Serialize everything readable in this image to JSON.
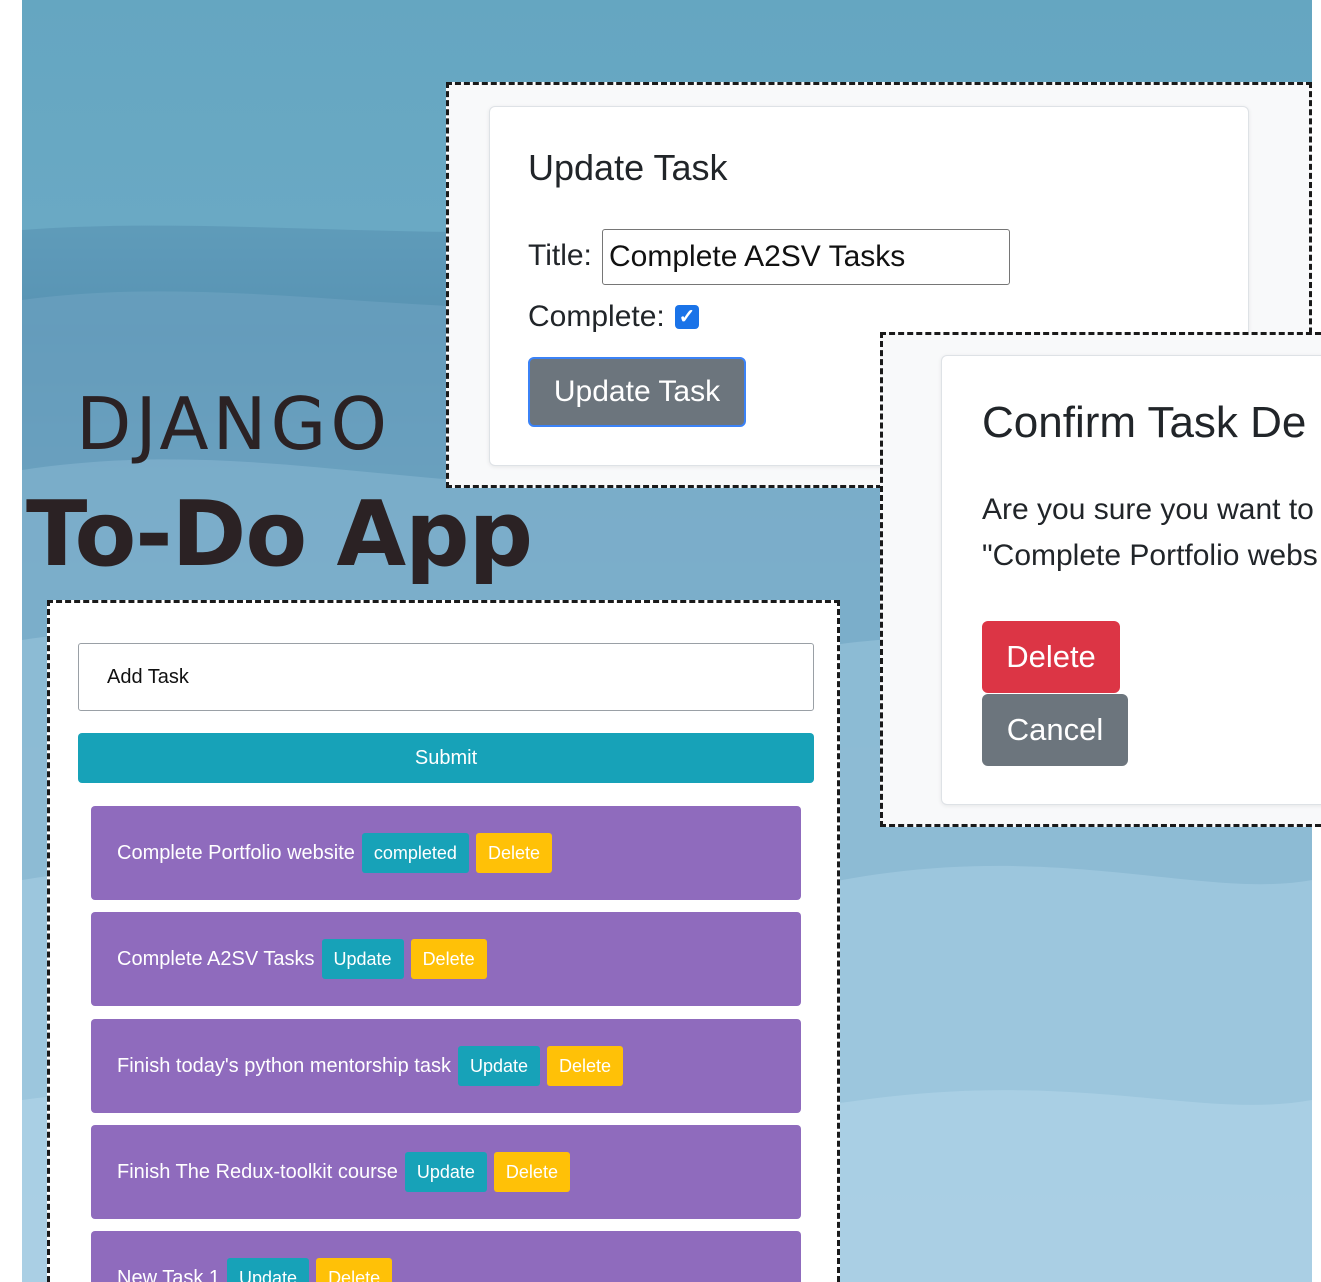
{
  "branding": {
    "framework": "DJANGO",
    "app_name": "To-Do App"
  },
  "update_panel": {
    "heading": "Update Task",
    "title_label": "Title:",
    "title_value": "Complete A2SV Tasks",
    "complete_label": "Complete:",
    "complete_checked": true,
    "submit_label": "Update Task"
  },
  "confirm_panel": {
    "heading": "Confirm Task De",
    "message_line1": "Are you sure you want to",
    "message_line2": "\"Complete Portfolio webs",
    "delete_label": "Delete",
    "cancel_label": "Cancel"
  },
  "todo_panel": {
    "add_placeholder": "Add Task",
    "submit_label": "Submit",
    "tasks": [
      {
        "title": "Complete Portfolio website",
        "status_label": "completed",
        "delete_label": "Delete"
      },
      {
        "title": "Complete A2SV Tasks",
        "status_label": "Update",
        "delete_label": "Delete"
      },
      {
        "title": "Finish today's python mentorship task",
        "status_label": "Update",
        "delete_label": "Delete"
      },
      {
        "title": "Finish The Redux-toolkit course",
        "status_label": "Update",
        "delete_label": "Delete"
      },
      {
        "title": "New Task 1",
        "status_label": "Update",
        "delete_label": "Delete"
      }
    ]
  },
  "colors": {
    "task_bg": "#8f6bbd",
    "info": "#17a2b8",
    "warning": "#ffc107",
    "danger": "#dc3545",
    "secondary": "#6c757d"
  }
}
